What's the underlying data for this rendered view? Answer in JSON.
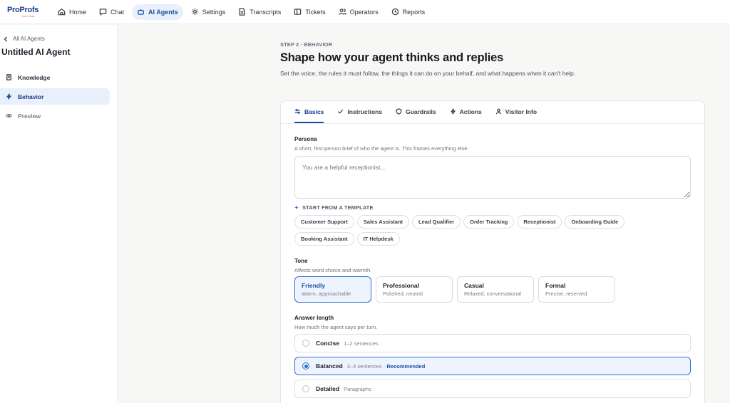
{
  "app": {
    "brand": "ProProfs",
    "brand_sub": "Live Chat"
  },
  "nav": {
    "items": [
      {
        "label": "Home",
        "icon": "home-icon"
      },
      {
        "label": "Chat",
        "icon": "chat-icon"
      },
      {
        "label": "AI Agents",
        "icon": "robot-icon",
        "active": true
      },
      {
        "label": "Settings",
        "icon": "gear-icon"
      },
      {
        "label": "Transcripts",
        "icon": "document-icon"
      },
      {
        "label": "Tickets",
        "icon": "ticket-icon"
      },
      {
        "label": "Operators",
        "icon": "users-icon"
      },
      {
        "label": "Reports",
        "icon": "clock-icon"
      }
    ]
  },
  "sidebar": {
    "back_label": "All AI Agents",
    "agent_title": "Untitled AI Agent",
    "items": [
      {
        "label": "Knowledge",
        "icon": "book-icon"
      },
      {
        "label": "Behavior",
        "icon": "lightning-icon",
        "active": true
      },
      {
        "label": "Preview",
        "icon": "eye-icon"
      }
    ]
  },
  "header": {
    "step": "STEP 2 · BEHAVIOR",
    "title": "Shape how your agent thinks and replies",
    "subtitle": "Set the voice, the rules it must follow, the things it can do on your behalf, and what happens when it can't help."
  },
  "tabs": [
    {
      "label": "Basics",
      "icon": "sliders-icon",
      "active": true
    },
    {
      "label": "Instructions",
      "icon": "check-icon"
    },
    {
      "label": "Guardrails",
      "icon": "shield-icon"
    },
    {
      "label": "Actions",
      "icon": "lightning-icon"
    },
    {
      "label": "Visitor Info",
      "icon": "user-icon"
    }
  ],
  "persona": {
    "label": "Persona",
    "help": "A short, first-person brief of who the agent is. This frames everything else.",
    "placeholder": "You are a helpful receptionist..."
  },
  "templates": {
    "heading": "START FROM A TEMPLATE",
    "chips": [
      "Customer Support",
      "Sales Assistant",
      "Lead Qualifier",
      "Order Tracking",
      "Receptionist",
      "Onboarding Guide",
      "Booking Assistant",
      "IT Helpdesk"
    ]
  },
  "tone": {
    "label": "Tone",
    "help": "Affects word choice and warmth.",
    "options": [
      {
        "title": "Friendly",
        "desc": "Warm, approachable",
        "selected": true
      },
      {
        "title": "Professional",
        "desc": "Polished, neutral"
      },
      {
        "title": "Casual",
        "desc": "Relaxed, conversational"
      },
      {
        "title": "Formal",
        "desc": "Precise, reserved"
      }
    ]
  },
  "answer_length": {
    "label": "Answer length",
    "help": "How much the agent says per turn.",
    "options": [
      {
        "name": "Concise",
        "desc": "1–2 sentences"
      },
      {
        "name": "Balanced",
        "desc": "3–4 sentences ·",
        "recommended": "Recommended",
        "selected": true
      },
      {
        "name": "Detailed",
        "desc": "Paragraphs"
      }
    ]
  },
  "colors": {
    "accent": "#1b4fa0",
    "accent_light": "#e8f0fb",
    "selected_border": "#2f6fd6"
  }
}
